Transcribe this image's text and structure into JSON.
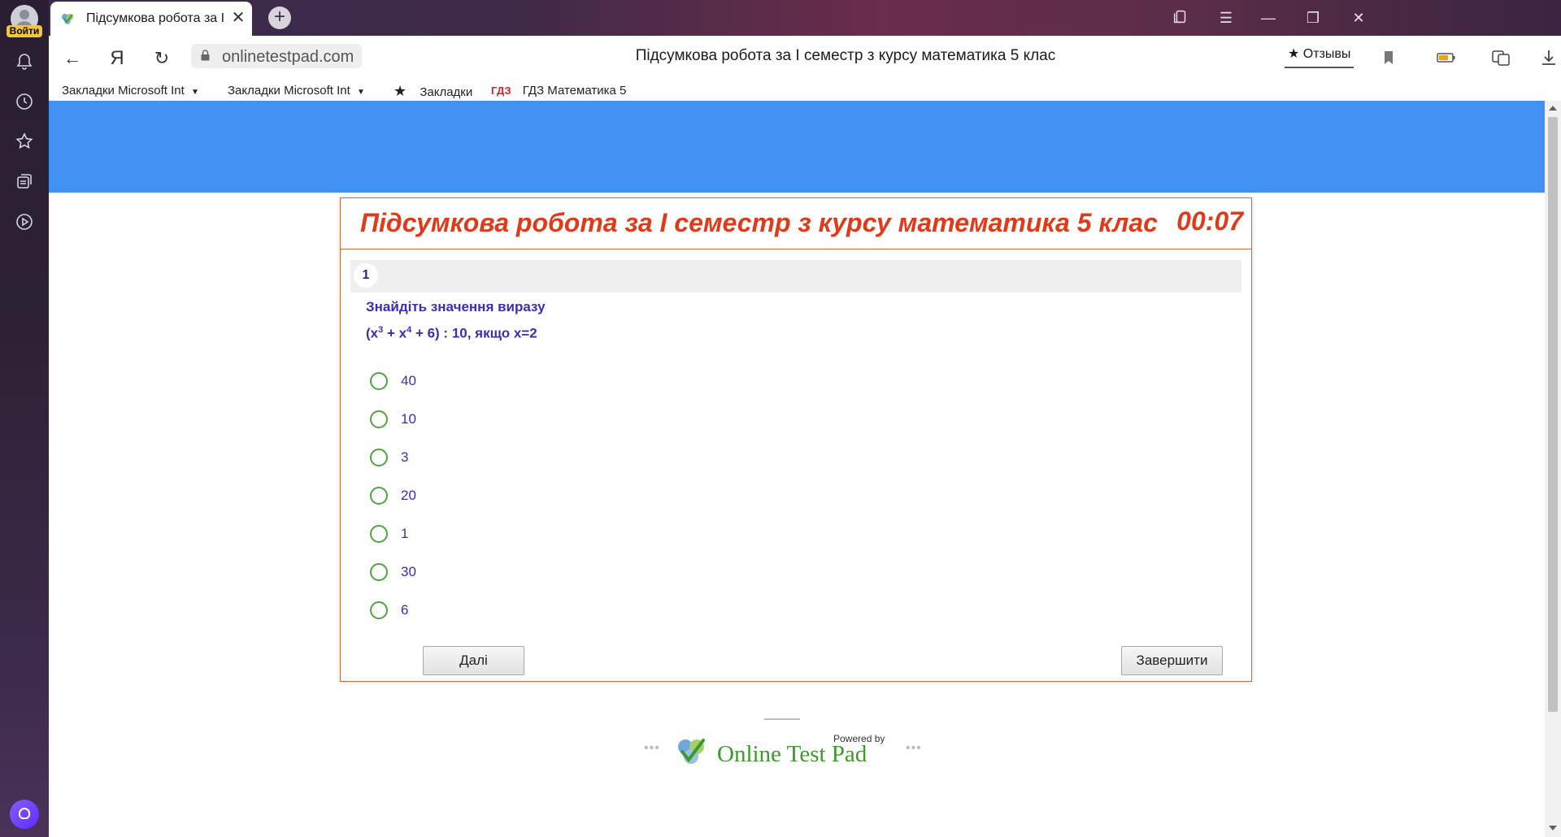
{
  "sidebar": {
    "login_label": "Войти",
    "icons": [
      "bell-icon",
      "history-icon",
      "star-icon",
      "collections-icon",
      "play-icon"
    ],
    "assistant_icon": "alice-assistant-icon"
  },
  "browser": {
    "tab_title": "Підсумкова робота за І",
    "url": "onlinetestpad.com",
    "page_title": "Підсумкова робота за І семестр з курсу математика 5 клас",
    "reviews_label": "★ Отзывы",
    "bookmarks": [
      {
        "label": "Закладки Microsoft Int",
        "type": "folder"
      },
      {
        "label": "Закладки Microsoft Int",
        "type": "folder"
      },
      {
        "label": "Закладки",
        "type": "star"
      },
      {
        "label": "ГДЗ Математика 5",
        "type": "gdz"
      }
    ]
  },
  "test": {
    "title": "Підсумкова робота за І семестр з курсу математика 5 клас",
    "timer": "00:07",
    "question_number": "1",
    "question_line1": "Знайдіть значення виразу",
    "expr_open": "(x",
    "exp1": "3",
    "expr_mid": " + x",
    "exp2": "4",
    "expr_end": " + 6) : 10, якщо x=2",
    "options": [
      "40",
      "10",
      "3",
      "20",
      "1",
      "30",
      "6"
    ],
    "next_button": "Далі",
    "finish_button": "Завершити"
  },
  "footer": {
    "powered_by": "Powered by",
    "brand": "Online Test Pad"
  },
  "colors": {
    "banner": "#4190f2",
    "title_red": "#e03a1a",
    "question_blue": "#3d2db3",
    "radio_green": "#4aa83a",
    "brand_green": "#3c9a2a"
  }
}
